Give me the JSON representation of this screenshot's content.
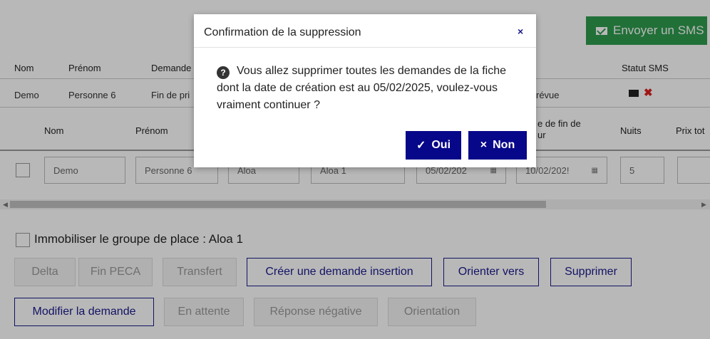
{
  "toolbar": {
    "sms_label": "Envoyer un SMS"
  },
  "top_table": {
    "headers": [
      "Nom",
      "Prénom",
      "Demande",
      "Statut SMS"
    ],
    "row": {
      "nom": "Demo",
      "prenom": "Personne 6",
      "demande": "Fin de pri",
      "statut": "révue"
    }
  },
  "grid": {
    "headers": {
      "nom": "Nom",
      "prenom": "Prénom",
      "date_fin": "e de fin de",
      "date_fin_2": "ur",
      "nuits": "Nuits",
      "prix": "Prix tot"
    },
    "row": {
      "nom": "Demo",
      "prenom": "Personne 6",
      "groupe": "Aloa",
      "place": "Aloa 1",
      "date_debut": "05/02/202",
      "date_fin": "10/02/202!",
      "nuits": "5",
      "prix": ""
    }
  },
  "immobiliser_label": "Immobiliser le groupe de place : Aloa 1",
  "actions": {
    "delta": "Delta",
    "fin_peca": "Fin PECA",
    "transfert": "Transfert",
    "creer_insertion": "Créer une demande insertion",
    "orienter_vers": "Orienter vers",
    "supprimer": "Supprimer",
    "modifier": "Modifier la demande",
    "en_attente": "En attente",
    "reponse_negative": "Réponse négative",
    "orientation": "Orientation"
  },
  "modal": {
    "title": "Confirmation de la suppression",
    "close": "×",
    "message": "Vous allez supprimer toutes les demandes de la fiche dont la date de création est au 05/02/2025, voulez-vous vraiment continuer ?",
    "yes": "Oui",
    "no": "Non"
  },
  "colors": {
    "accent": "#07078a",
    "sms_green": "#2e9b4e",
    "error_red": "#e01f1f"
  }
}
